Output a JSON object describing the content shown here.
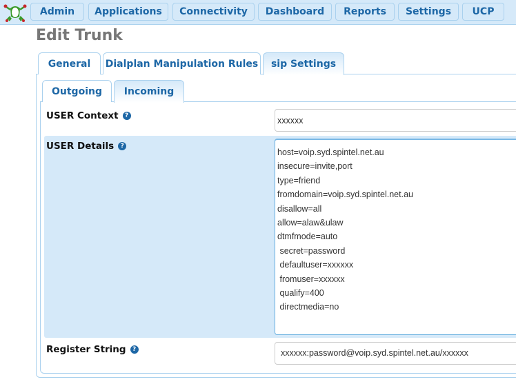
{
  "nav": {
    "logo": "frog-logo",
    "items": [
      "Admin",
      "Applications",
      "Connectivity",
      "Dashboard",
      "Reports",
      "Settings",
      "UCP"
    ]
  },
  "page": {
    "title": "Edit Trunk"
  },
  "tabs": [
    {
      "label": "General",
      "active": false
    },
    {
      "label": "Dialplan Manipulation Rules",
      "active": false
    },
    {
      "label": "sip Settings",
      "active": true
    }
  ],
  "subtabs": [
    {
      "label": "Outgoing",
      "active": false
    },
    {
      "label": "Incoming",
      "active": true
    }
  ],
  "form": {
    "user_context": {
      "label": "USER Context",
      "value": "xxxxxx"
    },
    "user_details": {
      "label": "USER Details",
      "lines": [
        "host=voip.syd.spintel.net.au",
        "insecure=invite,port",
        "type=friend",
        "fromdomain=voip.syd.spintel.net.au",
        "disallow=all",
        "allow=alaw&ulaw",
        "dtmfmode=auto",
        " secret=password",
        " defaultuser=xxxxxx",
        " fromuser=xxxxxx",
        " qualify=400",
        " directmedia=no"
      ]
    },
    "register_string": {
      "label": "Register String",
      "value": "xxxxxx:password@voip.syd.spintel.net.au/xxxxxx"
    },
    "help_glyph": "?"
  }
}
